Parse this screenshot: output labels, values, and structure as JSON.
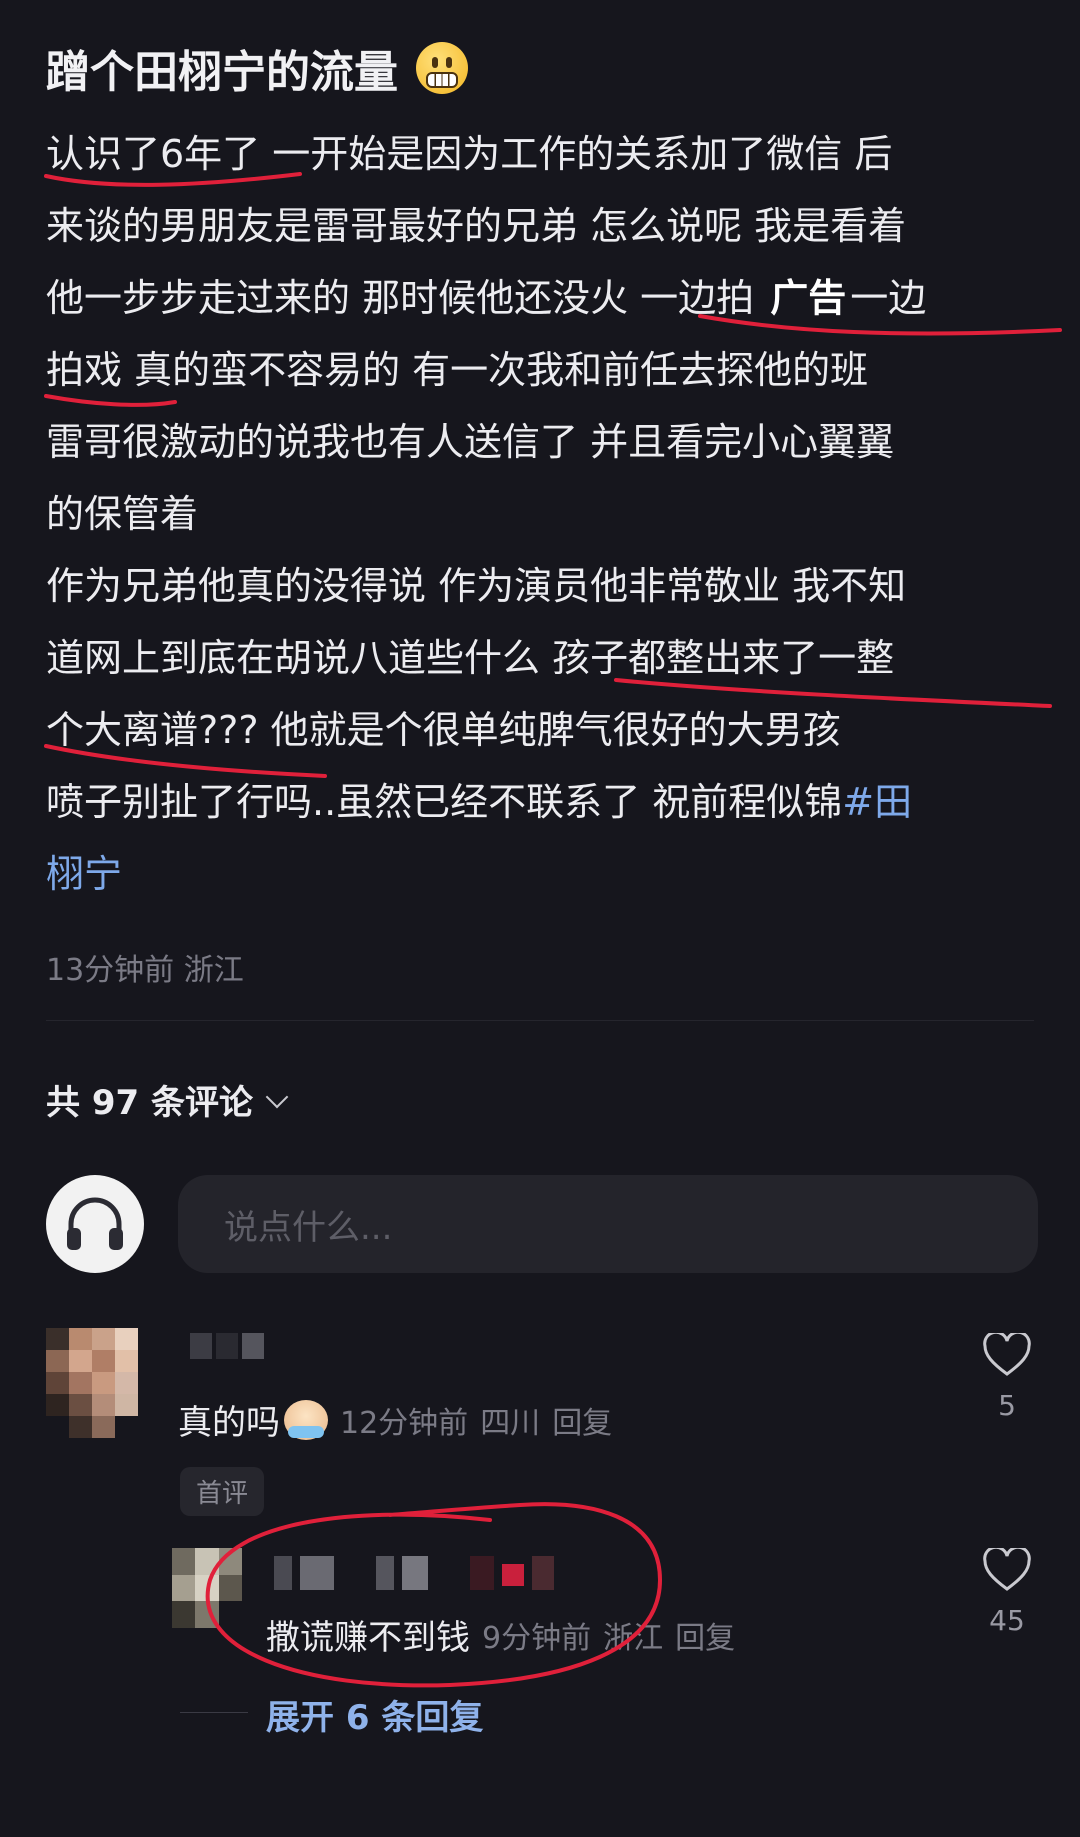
{
  "post": {
    "title": "蹭个田栩宁的流量",
    "title_emoji": "grimacing-face",
    "lines": [
      "认识了6年了 一开始是因为工作的关系加了微信 后",
      "来谈的男朋友是雷哥最好的兄弟 怎么说呢 我是看着",
      "他一步步走过来的 那时候他还没火 一边拍",
      "拍戏 真的蛮不容易的 有一次我和前任去探他的班",
      "雷哥很激动的说我也有人送信了 并且看完小心翼翼",
      "的保管着",
      "作为兄弟他真的没得说 作为演员他非常敬业 我不知",
      "道网上到底在胡说八道些什么 孩子都整出来了一整",
      "个大离谱??? 他就是个很单纯脾气很好的大男孩",
      "喷子别扯了行吗..虽然已经不联系了 祝前程似锦",
      "栩宁"
    ],
    "line3_overlay": "广告",
    "line3_tail": "一边",
    "hashtag_start": "#田",
    "meta": "13分钟前 浙江"
  },
  "comments_header": {
    "count_label": "共 97 条评论"
  },
  "composer": {
    "placeholder": "说点什么..."
  },
  "comments": [
    {
      "text": "真的吗",
      "time": "12分钟前",
      "location": "四川",
      "reply_label": "回复",
      "likes": "5",
      "badge": "首评"
    },
    {
      "text": "撒谎赚不到钱",
      "time": "9分钟前",
      "location": "浙江",
      "reply_label": "回复",
      "likes": "45"
    }
  ],
  "expand_label": "展开 6 条回复",
  "colors": {
    "background": "#16161d",
    "text": "#ececf0",
    "muted": "#7b7b86",
    "link": "#7ea9ea",
    "annotation": "#e0203a"
  }
}
